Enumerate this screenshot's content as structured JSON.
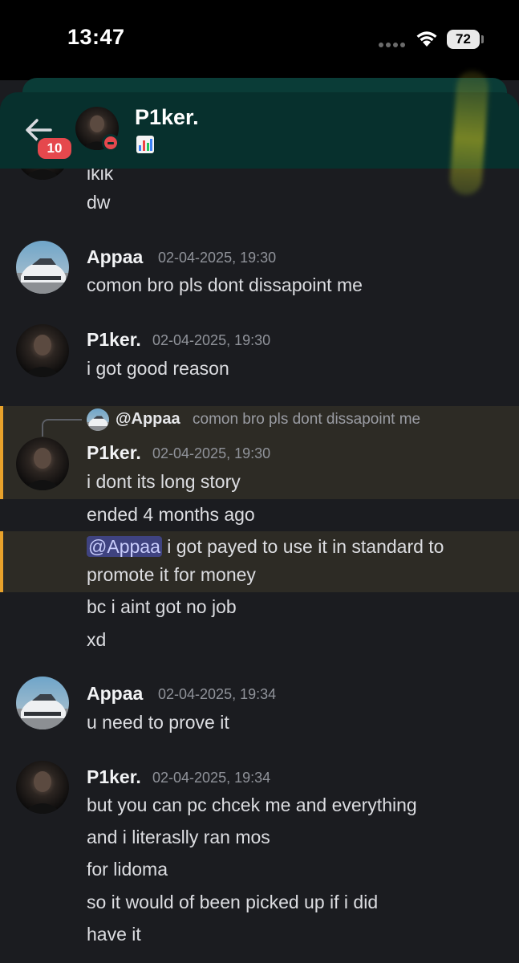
{
  "status_bar": {
    "time": "13:47",
    "battery": "72"
  },
  "header": {
    "name": "P1ker.",
    "notification_count": "10"
  },
  "messages": {
    "top_partial": "ikik",
    "top_line": "dw",
    "m1": {
      "author": "Appaa",
      "time": "02-04-2025, 19:30",
      "lines": [
        "comon bro pls dont dissapoint me"
      ]
    },
    "m2": {
      "author": "P1ker.",
      "time": "02-04-2025, 19:30",
      "lines": [
        "i got good reason"
      ]
    },
    "m3": {
      "reply_author": "@Appaa",
      "reply_text": "comon bro pls dont dissapoint me",
      "author": "P1ker.",
      "time": "02-04-2025, 19:30",
      "lines": [
        "i dont its long story",
        "ended 4 months ago"
      ],
      "mention": "@Appaa",
      "mention_rest": " i got payed to use it  in standard to",
      "mention_line2": "promote it for money",
      "after": [
        "bc i aint got no job",
        "xd"
      ]
    },
    "m4": {
      "author": "Appaa",
      "time": "02-04-2025, 19:34",
      "lines": [
        "u need to prove it"
      ]
    },
    "m5": {
      "author": "P1ker.",
      "time": "02-04-2025, 19:34",
      "lines": [
        "but you can pc chcek me and everything",
        "and i literaslly ran mos",
        "for lidoma",
        "so it would of been picked up if i did",
        "have it"
      ]
    }
  },
  "colors": {
    "background": "#1b1c20",
    "header": "#07302d",
    "highlight": "#2d2b25",
    "highlight_bar": "#e8a22b",
    "mention_bg": "#3f4380",
    "badge": "#e5484d"
  },
  "icons": {
    "back": "arrow-left-icon",
    "wifi": "wifi-icon",
    "status": "do-not-disturb-icon",
    "emoji": "bar-chart-emoji-icon"
  }
}
